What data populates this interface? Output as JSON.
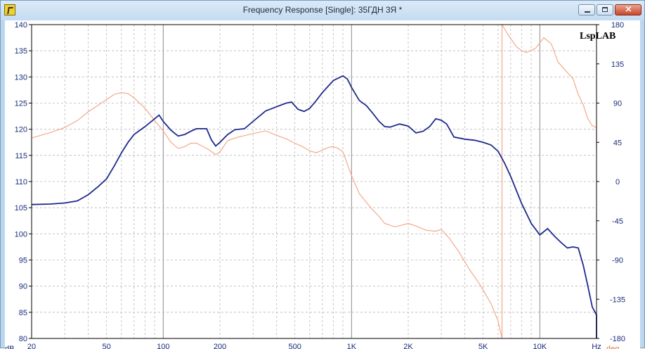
{
  "window": {
    "title": "Frequency Response [Single]: 35ГДН 3Я *",
    "icon": "app-icon",
    "buttons": [
      "minimize",
      "maximize",
      "close"
    ]
  },
  "watermark": "LspLAB",
  "chart_data": {
    "type": "line",
    "x_scale": "log",
    "xlim": [
      20,
      20000
    ],
    "x_ticks": [
      {
        "value": 20,
        "label": "20"
      },
      {
        "value": 50,
        "label": "50"
      },
      {
        "value": 100,
        "label": "100"
      },
      {
        "value": 200,
        "label": "200"
      },
      {
        "value": 500,
        "label": "500"
      },
      {
        "value": 1000,
        "label": "1K"
      },
      {
        "value": 2000,
        "label": "2K"
      },
      {
        "value": 5000,
        "label": "5K"
      },
      {
        "value": 10000,
        "label": "10K"
      },
      {
        "value": 20000,
        "label": "Hz"
      }
    ],
    "y_left": {
      "unit": "dB",
      "ylim": [
        80,
        140
      ],
      "ticks": [
        80,
        85,
        90,
        95,
        100,
        105,
        110,
        115,
        120,
        125,
        130,
        135,
        140
      ]
    },
    "y_right": {
      "unit": "deg",
      "ylim": [
        -180,
        180
      ],
      "ticks": [
        -180,
        -135,
        -90,
        -45,
        0,
        45,
        90,
        135,
        180
      ]
    },
    "grid": true,
    "colors": {
      "magnitude": "#1f2a8c",
      "phase": "#f4a98a",
      "axis_text": "#1a2d7a",
      "deg_unit": "#e0783a"
    },
    "series": [
      {
        "axis": "left",
        "points": [
          [
            20,
            105.6
          ],
          [
            25,
            105.7
          ],
          [
            30,
            105.9
          ],
          [
            35,
            106.3
          ],
          [
            40,
            107.5
          ],
          [
            45,
            109.0
          ],
          [
            50,
            110.5
          ],
          [
            55,
            113.0
          ],
          [
            60,
            115.5
          ],
          [
            65,
            117.5
          ],
          [
            70,
            119.0
          ],
          [
            80,
            120.5
          ],
          [
            90,
            122.0
          ],
          [
            95,
            122.7
          ],
          [
            100,
            121.5
          ],
          [
            110,
            119.8
          ],
          [
            120,
            118.7
          ],
          [
            130,
            119.0
          ],
          [
            140,
            119.6
          ],
          [
            150,
            120.1
          ],
          [
            170,
            120.1
          ],
          [
            180,
            118.0
          ],
          [
            190,
            116.8
          ],
          [
            200,
            117.5
          ],
          [
            220,
            119.0
          ],
          [
            240,
            119.9
          ],
          [
            270,
            120.1
          ],
          [
            300,
            121.5
          ],
          [
            350,
            123.5
          ],
          [
            400,
            124.3
          ],
          [
            450,
            125.0
          ],
          [
            480,
            125.2
          ],
          [
            520,
            123.8
          ],
          [
            560,
            123.4
          ],
          [
            600,
            124.0
          ],
          [
            650,
            125.5
          ],
          [
            700,
            127.0
          ],
          [
            800,
            129.3
          ],
          [
            900,
            130.2
          ],
          [
            950,
            129.6
          ],
          [
            1000,
            128.0
          ],
          [
            1100,
            125.5
          ],
          [
            1200,
            124.5
          ],
          [
            1300,
            123.0
          ],
          [
            1400,
            121.5
          ],
          [
            1500,
            120.5
          ],
          [
            1600,
            120.4
          ],
          [
            1800,
            121.0
          ],
          [
            2000,
            120.6
          ],
          [
            2200,
            119.3
          ],
          [
            2400,
            119.6
          ],
          [
            2600,
            120.5
          ],
          [
            2800,
            122.0
          ],
          [
            3000,
            121.7
          ],
          [
            3200,
            121.0
          ],
          [
            3500,
            118.5
          ],
          [
            4000,
            118.1
          ],
          [
            4500,
            117.9
          ],
          [
            5000,
            117.5
          ],
          [
            5500,
            117.0
          ],
          [
            6000,
            115.8
          ],
          [
            6500,
            113.5
          ],
          [
            7000,
            111.0
          ],
          [
            8000,
            105.8
          ],
          [
            9000,
            102.0
          ],
          [
            10000,
            99.8
          ],
          [
            11000,
            101.0
          ],
          [
            12000,
            99.5
          ],
          [
            13000,
            98.3
          ],
          [
            14000,
            97.3
          ],
          [
            15000,
            97.5
          ],
          [
            16000,
            97.3
          ],
          [
            17000,
            94.0
          ],
          [
            18000,
            90.0
          ],
          [
            19000,
            86.0
          ],
          [
            20000,
            84.5
          ],
          [
            20500,
            82.0
          ],
          [
            21000,
            80.0
          ]
        ]
      },
      {
        "axis": "right",
        "points": [
          [
            20,
            50
          ],
          [
            25,
            56
          ],
          [
            30,
            62
          ],
          [
            35,
            70
          ],
          [
            40,
            80
          ],
          [
            50,
            94
          ],
          [
            55,
            100
          ],
          [
            60,
            102
          ],
          [
            65,
            101
          ],
          [
            70,
            96
          ],
          [
            80,
            84
          ],
          [
            90,
            70
          ],
          [
            100,
            58
          ],
          [
            110,
            45
          ],
          [
            120,
            38
          ],
          [
            130,
            40
          ],
          [
            140,
            44
          ],
          [
            150,
            44
          ],
          [
            170,
            38
          ],
          [
            190,
            31
          ],
          [
            200,
            34
          ],
          [
            220,
            47
          ],
          [
            250,
            51
          ],
          [
            300,
            55
          ],
          [
            350,
            58
          ],
          [
            400,
            53
          ],
          [
            450,
            49
          ],
          [
            500,
            44
          ],
          [
            550,
            40
          ],
          [
            600,
            35
          ],
          [
            650,
            33
          ],
          [
            700,
            36
          ],
          [
            750,
            39
          ],
          [
            800,
            40
          ],
          [
            850,
            38
          ],
          [
            900,
            34
          ],
          [
            950,
            20
          ],
          [
            1000,
            7
          ],
          [
            1100,
            -14
          ],
          [
            1200,
            -24
          ],
          [
            1300,
            -33
          ],
          [
            1400,
            -40
          ],
          [
            1500,
            -48
          ],
          [
            1700,
            -52
          ],
          [
            2000,
            -48
          ],
          [
            2200,
            -51
          ],
          [
            2500,
            -56
          ],
          [
            2800,
            -57
          ],
          [
            3000,
            -55
          ],
          [
            3300,
            -65
          ],
          [
            3700,
            -80
          ],
          [
            4200,
            -100
          ],
          [
            4800,
            -118
          ],
          [
            5500,
            -140
          ],
          [
            6000,
            -160
          ],
          [
            6300,
            -180
          ],
          [
            6300,
            180
          ],
          [
            6800,
            168
          ],
          [
            7500,
            155
          ],
          [
            8000,
            150
          ],
          [
            8500,
            148
          ],
          [
            9500,
            153
          ],
          [
            10500,
            165
          ],
          [
            11500,
            158
          ],
          [
            12500,
            137
          ],
          [
            14000,
            125
          ],
          [
            15000,
            118
          ],
          [
            16000,
            100
          ],
          [
            17000,
            88
          ],
          [
            18000,
            72
          ],
          [
            19000,
            64
          ],
          [
            20000,
            62
          ],
          [
            20800,
            50
          ],
          [
            21000,
            38
          ]
        ]
      }
    ]
  }
}
